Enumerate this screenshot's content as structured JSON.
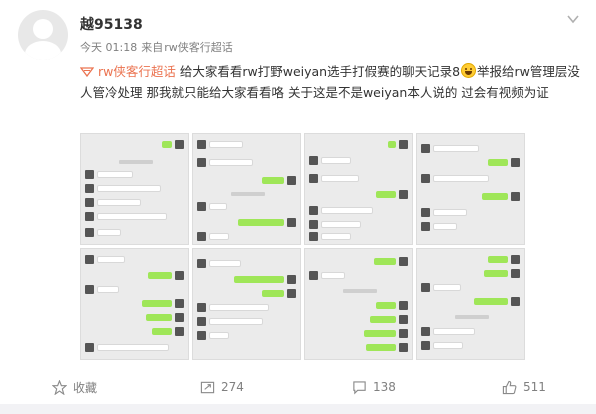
{
  "post": {
    "username": "越95138",
    "time": "今天 01:18",
    "source_prefix": "来自",
    "source": "rw侠客行超话",
    "topic": "rw侠客行超话",
    "text_part1": "给大家看看rw打野weiyan选手打假赛的聊天记录8",
    "text_part2": "举报给rw管理层没人管冷处理 那我就只能给大家看看咯 关于这是不是weiyan本人说的 过会有视频为证"
  },
  "actions": {
    "favorite_label": "收藏",
    "repost_count": "274",
    "comment_count": "138",
    "like_count": "511"
  },
  "colors": {
    "topic": "#eb7350",
    "chat_bubble_me": "#9fe658",
    "chat_background": "#ebebeb"
  },
  "icons": [
    "user-avatar",
    "chevron-down-icon",
    "supertopic-icon",
    "grin-emoji",
    "star-icon",
    "repost-icon",
    "comment-icon",
    "like-icon"
  ]
}
